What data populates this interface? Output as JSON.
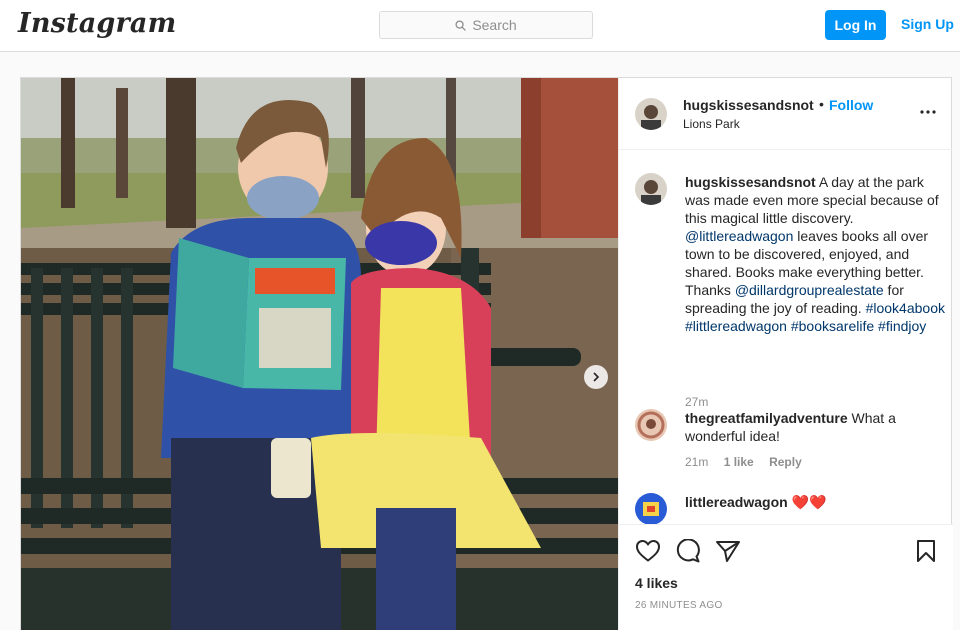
{
  "header": {
    "logo": "Instagram",
    "search_placeholder": "Search",
    "login_label": "Log In",
    "signup_label": "Sign Up"
  },
  "post": {
    "author": "hugskissesandsnot",
    "separator": "•",
    "follow_label": "Follow",
    "location": "Lions Park",
    "caption": {
      "author": "hugskissesandsnot",
      "text_1": " A day at the park was made even more special because of this magical little discovery. ",
      "mention_1": "@littlereadwagon",
      "text_2": " leaves books all over town to be discovered, enjoyed, and shared. Books make everything better. Thanks ",
      "mention_2": "@dillardgrouprealestate",
      "text_3": " for spreading the joy of reading. ",
      "hashtag_1": "#look4abook",
      "hashtag_2": "#littlereadwagon",
      "hashtag_3": "#booksarelife",
      "hashtag_4": "#findjoy",
      "time": "27m"
    },
    "comments": [
      {
        "author": "thegreatfamilyadventure",
        "text": " What a wonderful idea!",
        "time": "21m",
        "likes": "1 like",
        "reply": "Reply"
      },
      {
        "author": "littlereadwagon",
        "text": " ❤️❤️"
      }
    ],
    "likes_count": "4 likes",
    "posted_ago": "26 MINUTES AGO"
  },
  "icons": {
    "search": "search-icon",
    "more": "more-options-icon",
    "like": "heart-icon",
    "comment": "comment-bubble-icon",
    "share": "paper-plane-icon",
    "save": "bookmark-icon",
    "next": "chevron-right-icon"
  },
  "colors": {
    "brand_blue": "#0095f6",
    "mention_blue": "#00376b",
    "muted_gray": "#8e8e8e"
  }
}
